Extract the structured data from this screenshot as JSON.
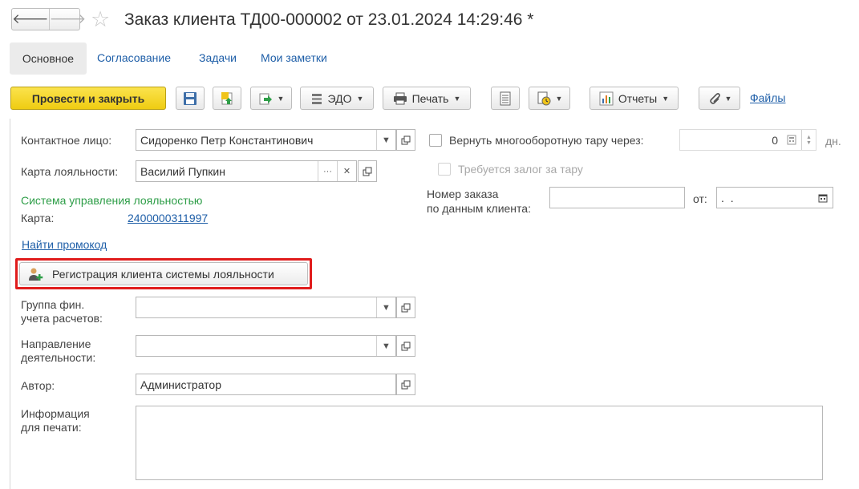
{
  "header": {
    "back_icon": "arrow-left-icon",
    "forward_icon": "arrow-right-icon",
    "favorite_icon": "star-icon",
    "title": "Заказ клиента ТД00-000002 от 23.01.2024 14:29:46 *"
  },
  "tabs": [
    {
      "label": "Основное",
      "active": true
    },
    {
      "label": "Согласование"
    },
    {
      "label": "Задачи"
    },
    {
      "label": "Мои заметки"
    }
  ],
  "toolbar": {
    "post_close": "Провести и закрыть",
    "edo": "ЭДО",
    "print": "Печать",
    "reports": "Отчеты",
    "files": "Файлы"
  },
  "form": {
    "contact_label": "Контактное лицо:",
    "contact_value": "Сидоренко Петр Константинович",
    "loyalty_card_label": "Карта лояльности:",
    "loyalty_card_value": "Василий Пупкин",
    "loyalty_system": "Система управления лояльностью",
    "card_label": "Карта:",
    "card_number": "2400000311997",
    "promo_link": "Найти промокод",
    "register_button": "Регистрация клиента системы лояльности",
    "fin_group_label_1": "Группа фин.",
    "fin_group_label_2": "учета расчетов:",
    "fin_group_value": "",
    "direction_label_1": "Направление",
    "direction_label_2": "деятельности:",
    "direction_value": "",
    "author_label": "Автор:",
    "author_value": "Администратор",
    "print_info_label_1": "Информация",
    "print_info_label_2": "для печати:",
    "print_info_value": "",
    "return_tara_label": "Вернуть многооборотную тару через:",
    "return_tara_value": "0",
    "days_unit": "дн.",
    "deposit_label": "Требуется залог за тару",
    "client_order_label_1": "Номер заказа",
    "client_order_label_2": "по данным клиента:",
    "client_order_value": "",
    "from_label": "от:",
    "from_date_value": " .  ."
  },
  "colors": {
    "primary_button": "#f4d420",
    "link": "#1f5fa8",
    "loyalty_text": "#2e9e48",
    "highlight_frame": "#e01c1c"
  }
}
